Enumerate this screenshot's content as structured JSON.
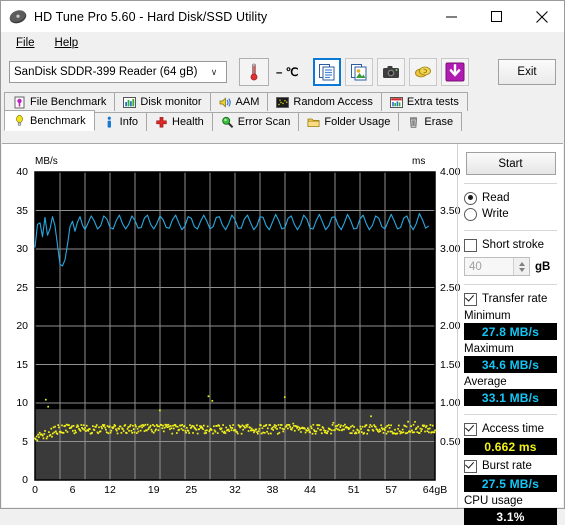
{
  "window": {
    "title": "HD Tune Pro 5.60 - Hard Disk/SSD Utility",
    "minimize": "—",
    "maximize": "☐",
    "close": "✕"
  },
  "menu": {
    "items": [
      "File",
      "Help"
    ]
  },
  "toolbar": {
    "device": "SanDisk  SDDR-399 Reader (64 gB)",
    "chevron": "∨",
    "temperature": "– ℃",
    "exit_label": "Exit",
    "buttons": [
      {
        "name": "copy-icon",
        "selected": true
      },
      {
        "name": "copy-image-icon",
        "selected": false
      },
      {
        "name": "camera-icon",
        "selected": false
      },
      {
        "name": "coins-icon",
        "selected": false
      },
      {
        "name": "download-icon",
        "selected": false
      }
    ]
  },
  "tabs_row1": [
    {
      "label": "File Benchmark",
      "icon": "file-benchmark-icon",
      "active": false
    },
    {
      "label": "Disk monitor",
      "icon": "disk-monitor-icon",
      "active": false
    },
    {
      "label": "AAM",
      "icon": "speaker-icon",
      "active": false
    },
    {
      "label": "Random Access",
      "icon": "random-access-icon",
      "active": false
    },
    {
      "label": "Extra tests",
      "icon": "extra-tests-icon",
      "active": false
    }
  ],
  "tabs_row2": [
    {
      "label": "Benchmark",
      "icon": "benchmark-icon",
      "active": true
    },
    {
      "label": "Info",
      "icon": "info-icon",
      "active": false
    },
    {
      "label": "Health",
      "icon": "health-icon",
      "active": false
    },
    {
      "label": "Error Scan",
      "icon": "error-scan-icon",
      "active": false
    },
    {
      "label": "Folder Usage",
      "icon": "folder-usage-icon",
      "active": false
    },
    {
      "label": "Erase",
      "icon": "erase-icon",
      "active": false
    }
  ],
  "panel": {
    "start_label": "Start",
    "mode_read": "Read",
    "mode_write": "Write",
    "mode_selected": "Read",
    "short_stroke_label": "Short stroke",
    "short_stroke_checked": false,
    "short_stroke_value": "40",
    "short_stroke_unit": "gB",
    "transfer_rate_label": "Transfer rate",
    "transfer_rate_checked": true,
    "minimum_label": "Minimum",
    "minimum_value": "27.8 MB/s",
    "maximum_label": "Maximum",
    "maximum_value": "34.6 MB/s",
    "average_label": "Average",
    "average_value": "33.1 MB/s",
    "access_time_label": "Access time",
    "access_time_checked": true,
    "access_time_value": "0.662 ms",
    "burst_rate_label": "Burst rate",
    "burst_rate_checked": true,
    "burst_rate_value": "27.5 MB/s",
    "cpu_usage_label": "CPU usage",
    "cpu_usage_value": "3.1%"
  },
  "chart_data": {
    "type": "line",
    "title": "",
    "xlabel": "",
    "ylabel": "MB/s",
    "y2label": "ms",
    "xlim": [
      0,
      64
    ],
    "ylim": [
      0,
      40
    ],
    "y2lim": [
      0,
      4.0
    ],
    "grid": true,
    "xticks": [
      "0",
      "6",
      "12",
      "19",
      "25",
      "32",
      "38",
      "44",
      "51",
      "57",
      "64gB"
    ],
    "xtick_values": [
      0,
      6,
      12,
      19,
      25,
      32,
      38,
      44,
      51,
      57,
      64
    ],
    "yticks": [
      "0",
      "5",
      "10",
      "15",
      "20",
      "25",
      "30",
      "35",
      "40"
    ],
    "ytick_values": [
      0,
      5,
      10,
      15,
      20,
      25,
      30,
      35,
      40
    ],
    "y2ticks": [
      "0.50",
      "1.00",
      "1.50",
      "2.00",
      "2.50",
      "3.00",
      "3.50",
      "4.00"
    ],
    "y2tick_values": [
      0.5,
      1.0,
      1.5,
      2.0,
      2.5,
      3.0,
      3.5,
      4.0
    ],
    "series": [
      {
        "name": "Transfer rate",
        "type": "line",
        "axis": "left",
        "color": "#29a8e0",
        "x": [
          0,
          0.4,
          0.8,
          1.2,
          1.6,
          2.0,
          2.4,
          2.8,
          3.2,
          3.6,
          4.0,
          4.4,
          4.8,
          5.2,
          5.6,
          6.0,
          6.4,
          6.8,
          7.2,
          7.6,
          8.0,
          8.5,
          9.0,
          9.5,
          10.0,
          10.5,
          11.0,
          11.5,
          12.0,
          12.5,
          13.0,
          13.5,
          14.0,
          14.5,
          15.0,
          15.5,
          16.0,
          16.5,
          17.0,
          17.5,
          18.0,
          18.5,
          19.0,
          19.5,
          20.0,
          20.5,
          21.0,
          21.5,
          22.0,
          22.5,
          23.0,
          23.5,
          24.0,
          24.5,
          25.0,
          25.5,
          26.0,
          26.5,
          27.0,
          27.5,
          28.0,
          28.5,
          29.0,
          29.5,
          30.0,
          30.5,
          31.0,
          31.5,
          32.0,
          32.5,
          33.0,
          33.5,
          34.0,
          34.5,
          35.0,
          35.5,
          36.0,
          36.5,
          37.0,
          37.5,
          38.0,
          38.5,
          39.0,
          39.5,
          40.0,
          40.5,
          41.0,
          41.5,
          42.0,
          42.5,
          43.0,
          43.5,
          44.0,
          44.5,
          45.0,
          45.5,
          46.0,
          46.5,
          47.0,
          47.5,
          48.0,
          48.5,
          49.0,
          49.5,
          50.0,
          50.5,
          51.0,
          51.5,
          52.0,
          52.5,
          53.0,
          53.5,
          54.0,
          54.5,
          55.0,
          55.5,
          56.0,
          56.5,
          57.0,
          57.5,
          58.0,
          58.5,
          59.0,
          59.5,
          60.0,
          60.5,
          61.0,
          61.5,
          62.0,
          62.5,
          63.0,
          63.5,
          64.0
        ],
        "y": [
          30.2,
          33.2,
          33.4,
          31.6,
          34.1,
          31.8,
          32.6,
          34.2,
          33.0,
          30.5,
          28.0,
          27.8,
          28.6,
          30.6,
          32.9,
          33.6,
          32.3,
          33.5,
          34.2,
          33.1,
          32.5,
          33.4,
          34.3,
          33.6,
          32.6,
          33.0,
          34.3,
          33.9,
          32.8,
          32.6,
          33.7,
          34.4,
          33.3,
          32.6,
          33.2,
          34.3,
          33.7,
          32.7,
          32.8,
          34.0,
          34.4,
          33.2,
          32.6,
          33.3,
          34.3,
          33.8,
          32.8,
          32.7,
          33.8,
          34.4,
          33.4,
          32.5,
          33.0,
          34.2,
          34.0,
          32.9,
          32.6,
          33.6,
          34.4,
          33.6,
          32.6,
          32.9,
          34.1,
          34.2,
          33.1,
          32.5,
          33.3,
          34.4,
          33.8,
          32.7,
          32.7,
          33.9,
          34.4,
          33.4,
          32.5,
          33.0,
          34.2,
          34.1,
          33.0,
          32.5,
          33.5,
          34.5,
          33.7,
          32.6,
          32.8,
          34.0,
          34.3,
          33.2,
          32.5,
          33.2,
          34.4,
          33.9,
          32.7,
          32.6,
          33.7,
          34.5,
          33.5,
          32.5,
          33.0,
          34.1,
          34.2,
          33.1,
          32.5,
          33.4,
          34.5,
          33.7,
          32.6,
          32.7,
          33.9,
          34.4,
          33.3,
          32.5,
          33.1,
          34.3,
          34.0,
          32.9,
          32.6,
          33.6,
          34.5,
          33.6,
          32.6,
          32.8,
          34.0,
          34.3,
          33.2,
          32.5,
          33.3,
          34.6,
          33.8,
          32.7,
          33.0
        ],
        "min": 27.8,
        "max": 34.6,
        "average": 33.1
      },
      {
        "name": "Access time",
        "type": "scatter",
        "axis": "right",
        "color": "#f2f218",
        "average_ms": 0.662,
        "cluster_center_ms": 0.66,
        "cluster_spread_ms": 0.12,
        "outlier_max_ms": 1.15,
        "point_count": 520
      }
    ]
  }
}
